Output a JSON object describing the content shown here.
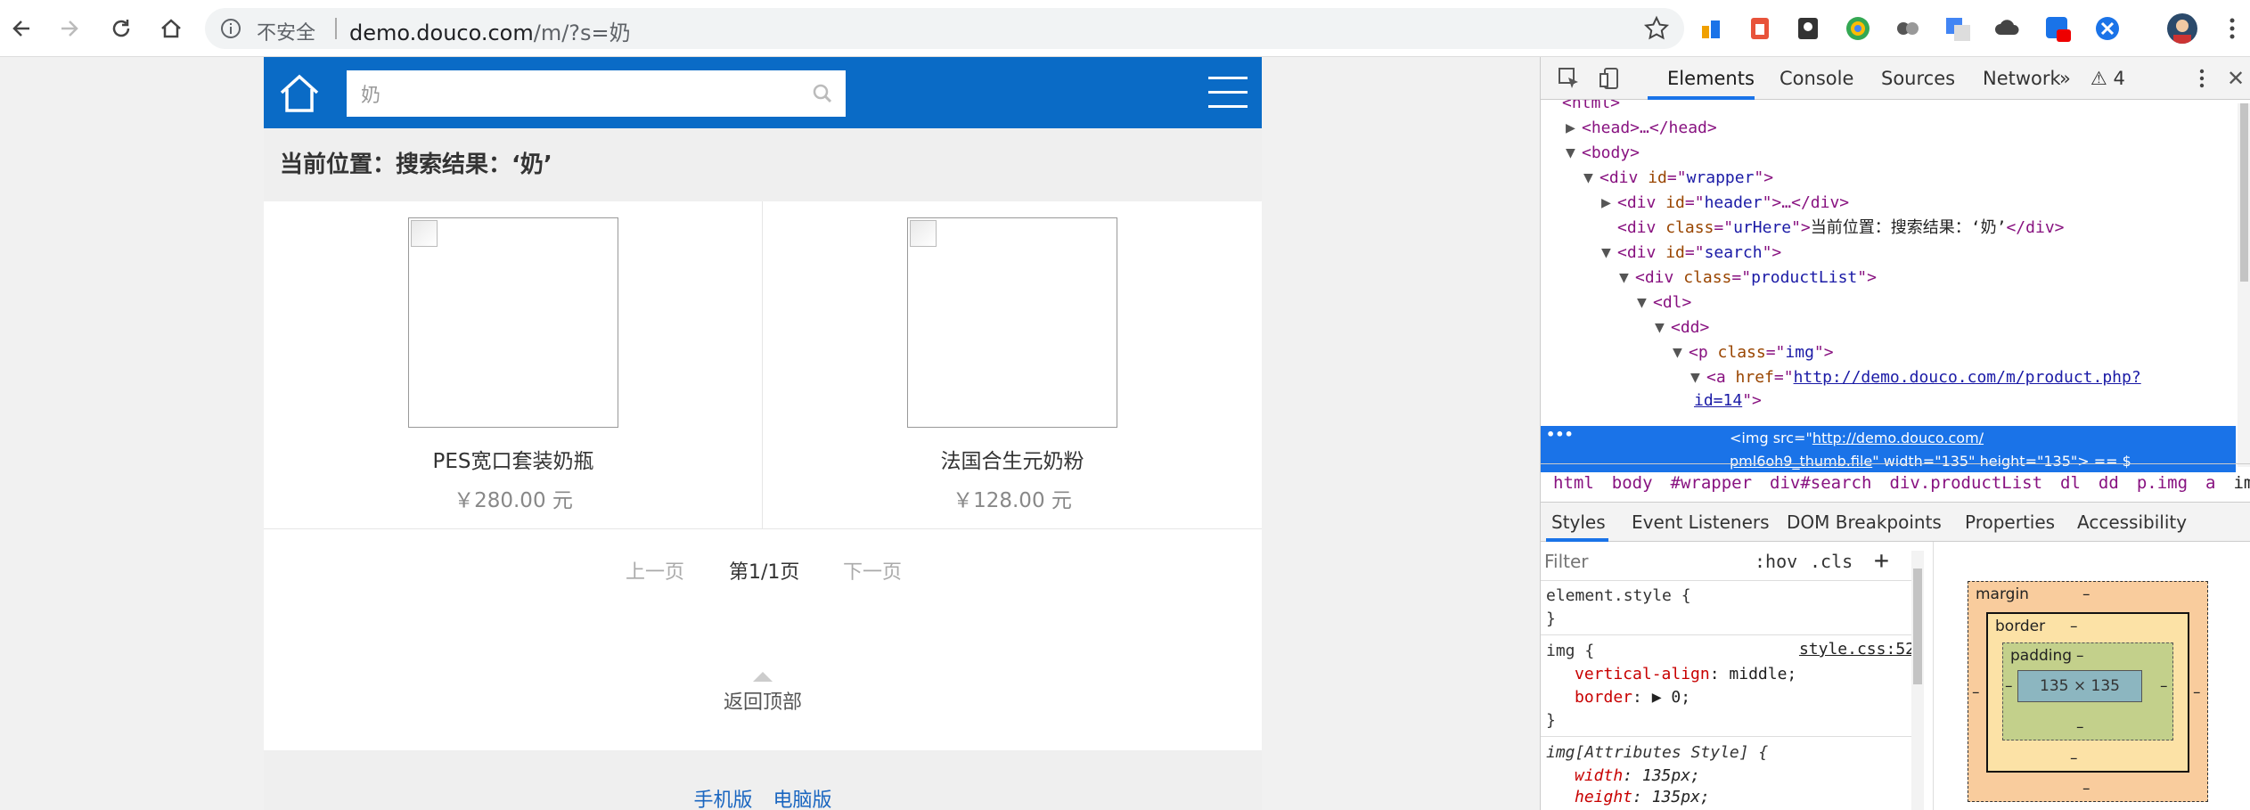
{
  "browser": {
    "insecure_label": "不安全",
    "url_host": "demo.douco.com",
    "url_path": "/m/?s=奶"
  },
  "page": {
    "search_value": "奶",
    "breadcrumb": "当前位置：搜索结果：‘奶’",
    "products": [
      {
        "name": "PES宽口套装奶瓶",
        "price": "￥280.00 元"
      },
      {
        "name": "法国合生元奶粉",
        "price": "￥128.00 元"
      }
    ],
    "pager": {
      "prev": "上一页",
      "current": "第1/1页",
      "next": "下一页"
    },
    "back_top": "返回顶部",
    "footer": {
      "mobile": "手机版",
      "pc": "电脑版"
    }
  },
  "devtools": {
    "tabs": [
      "Elements",
      "Console",
      "Sources",
      "Network",
      "»"
    ],
    "warnings": "⚠ 4",
    "dom": {
      "l0": "<html>",
      "l1_tag": "<head>…</head>",
      "l2_tag": "<body>",
      "l3_id": "wrapper",
      "l4_id": "header",
      "l5_class": "urHere",
      "l5_text": "当前位置：搜索结果：‘奶’",
      "l6_id": "search",
      "l7_class": "productList",
      "l8_tag": "<dl>",
      "l9_tag": "<dd>",
      "l10_class": "img",
      "l11_href": "http://demo.douco.com/m/product.php?",
      "l11_href2": "id=14",
      "l12_src": "http://demo.douco.com/",
      "l12_src2": "pml6oh9_thumb.file",
      "l12_width": "135",
      "l12_height": "135",
      "l12_tail": "== $"
    },
    "breadcrumbs": [
      "html",
      "body",
      "#wrapper",
      "div#search",
      "div.productList",
      "dl",
      "dd",
      "p.img",
      "a",
      "img"
    ],
    "subtabs": [
      "Styles",
      "Event Listeners",
      "DOM Breakpoints",
      "Properties",
      "Accessibility"
    ],
    "filter_placeholder": "Filter",
    "hov": ":hov",
    "cls": ".cls",
    "styles": {
      "element_style": "element.style {",
      "close": "}",
      "img_sel": "img {",
      "img_src": "style.css:52",
      "p1_name": "vertical-align",
      "p1_val": "middle;",
      "p2_name": "border",
      "p2_val": "0;",
      "attr_sel": "img[Attributes Style] {",
      "p3_name": "width",
      "p3_val": "135px;",
      "p4_name": "height",
      "p4_val": "135px;"
    },
    "box_model": {
      "margin": "margin",
      "border": "border",
      "padding": "padding",
      "content": "135 × 135",
      "dash": "–"
    }
  }
}
